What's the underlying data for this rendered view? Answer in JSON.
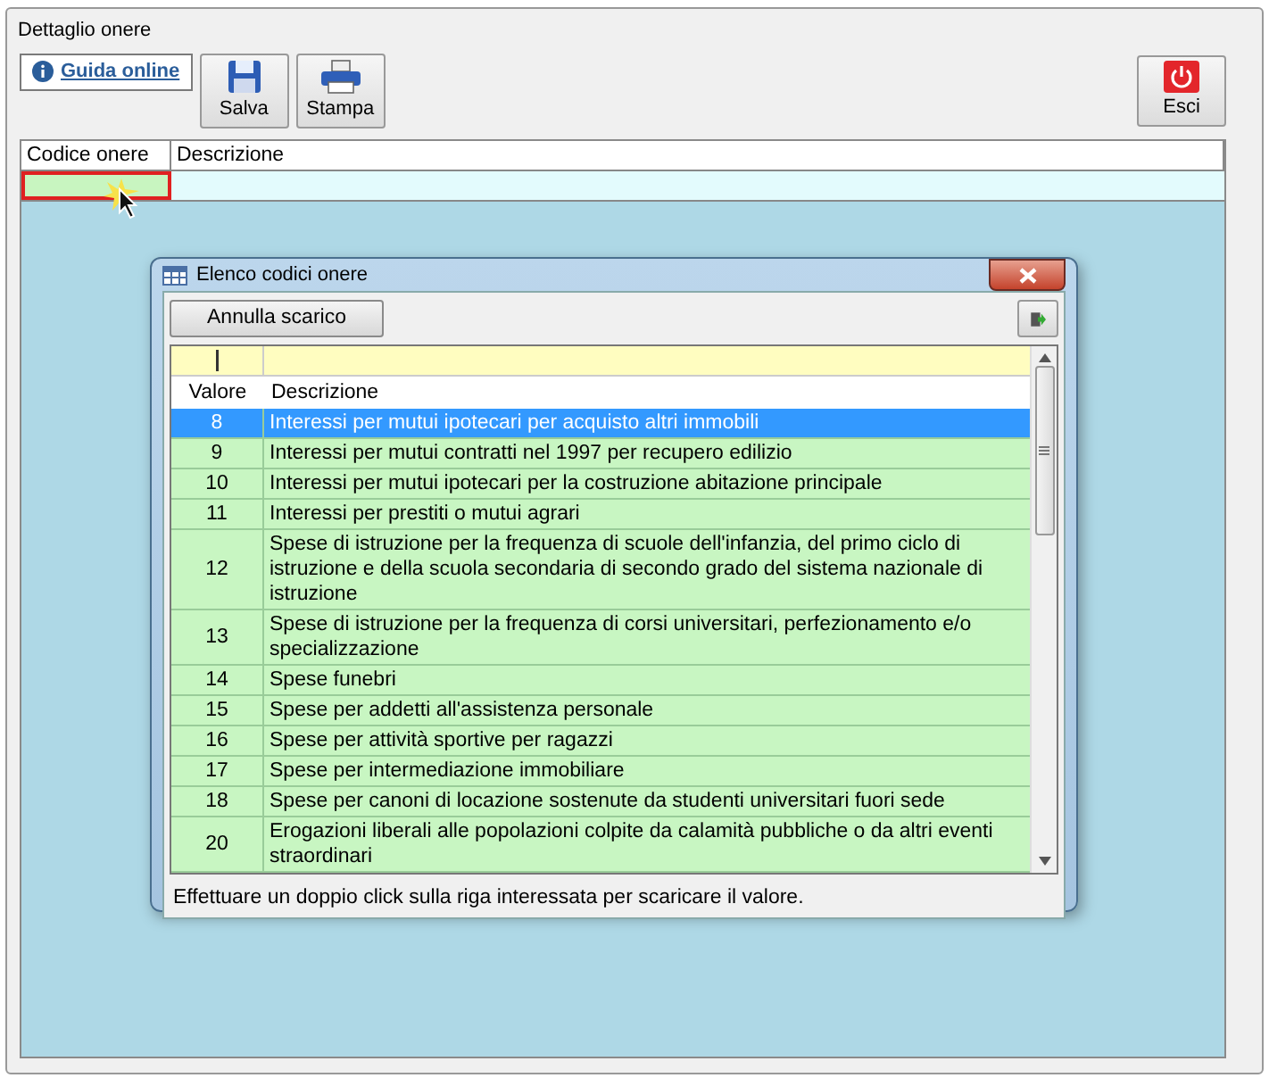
{
  "window": {
    "title": "Dettaglio onere"
  },
  "toolbar": {
    "help_link": "Guida online",
    "buttons": [
      {
        "label": "Salva",
        "kind": "save"
      },
      {
        "label": "Stampa",
        "kind": "print"
      }
    ],
    "exit_button": "Esci"
  },
  "grid": {
    "columns": [
      "Codice onere",
      "Descrizione"
    ],
    "focused_cell": true
  },
  "dialog": {
    "title": "Elenco codici onere",
    "button": "Annulla scarico",
    "columns": [
      "Valore",
      "Descrizione"
    ],
    "rows": [
      {
        "value": "8",
        "description": "Interessi per mutui ipotecari per acquisto altri immobili",
        "selected": true
      },
      {
        "value": "9",
        "description": "Interessi per mutui contratti nel 1997 per recupero edilizio",
        "selected": false
      },
      {
        "value": "10",
        "description": "Interessi per mutui ipotecari per la costruzione abitazione principale",
        "selected": false
      },
      {
        "value": "11",
        "description": "Interessi per prestiti o mutui agrari",
        "selected": false
      },
      {
        "value": "12",
        "description": "Spese di istruzione per la frequenza di scuole dell'infanzia, del primo ciclo di istruzione e della scuola secondaria di secondo grado del sistema nazionale di istruzione",
        "selected": false
      },
      {
        "value": "13",
        "description": "Spese di istruzione per la frequenza di corsi universitari, perfezionamento e/o specializzazione",
        "selected": false
      },
      {
        "value": "14",
        "description": "Spese funebri",
        "selected": false
      },
      {
        "value": "15",
        "description": "Spese per addetti all'assistenza personale",
        "selected": false
      },
      {
        "value": "16",
        "description": "Spese per attività sportive per ragazzi",
        "selected": false
      },
      {
        "value": "17",
        "description": "Spese per intermediazione immobiliare",
        "selected": false
      },
      {
        "value": "18",
        "description": "Spese per canoni di locazione sostenute da studenti universitari fuori sede",
        "selected": false
      },
      {
        "value": "20",
        "description": "Erogazioni liberali alle popolazioni colpite da calamità pubbliche o da altri eventi straordinari",
        "selected": false
      }
    ],
    "hint": "Effettuare un doppio click sulla riga interessata per scaricare il valore."
  }
}
